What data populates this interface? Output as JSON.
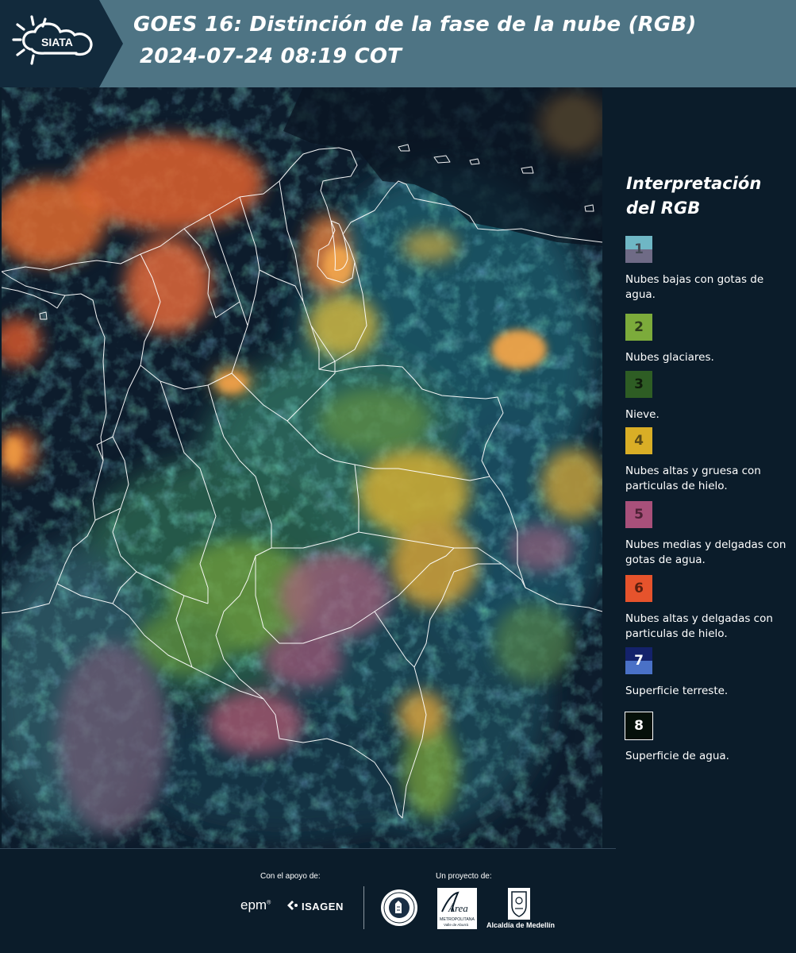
{
  "header": {
    "logo_text": "SIATA",
    "title_line1": "GOES 16: Distinción de la fase de la nube (RGB)",
    "title_line2": "2024-07-24 08:19 COT"
  },
  "legend": {
    "title_line1": "Interpretación",
    "title_line2": "del RGB",
    "items": [
      {
        "number": "1",
        "top_color": "#6fb7c5",
        "bottom_color": "#6f6b86",
        "text_color": "#444a55",
        "label": "Nubes bajas con gotas de agua."
      },
      {
        "number": "2",
        "top_color": "#7cab3b",
        "bottom_color": "#7cab3b",
        "text_color": "#2d3d1a",
        "label": "Nubes glaciares."
      },
      {
        "number": "3",
        "top_color": "#2e5d24",
        "bottom_color": "#2e5d24",
        "text_color": "#0f1d0b",
        "label": "Nieve."
      },
      {
        "number": "4",
        "top_color": "#d9ae26",
        "bottom_color": "#d9ae26",
        "text_color": "#5a4a16",
        "label": "Nubes altas y gruesa con particulas de hielo."
      },
      {
        "number": "5",
        "top_color": "#a8507a",
        "bottom_color": "#a8507a",
        "text_color": "#4d2135",
        "label": "Nubes medias y delgadas con gotas de agua."
      },
      {
        "number": "6",
        "top_color": "#e6532c",
        "bottom_color": "#e6532c",
        "text_color": "#5c1f0e",
        "label": "Nubes altas y delgadas con particulas de hielo."
      },
      {
        "number": "7",
        "top_color": "#14226b",
        "bottom_color": "#4a71c7",
        "text_color": "#ffffff",
        "label": "Superficie terreste."
      },
      {
        "number": "8",
        "top_color": "#05100a",
        "bottom_color": "#05100a",
        "text_color": "#ffffff",
        "label": "Superficie de agua."
      }
    ]
  },
  "footer": {
    "support_label": "Con el apoyo de:",
    "project_label": "Un proyecto de:",
    "epm_logo_text": "epm",
    "isagen_logo_text": "ISAGEN",
    "area_logo_text": "Área",
    "area_logo_subtext": "METROPOLITANA",
    "area_logo_subtext2": "Valle de Aburrá",
    "alcaldia_label": "Alcaldía de Medellín"
  }
}
